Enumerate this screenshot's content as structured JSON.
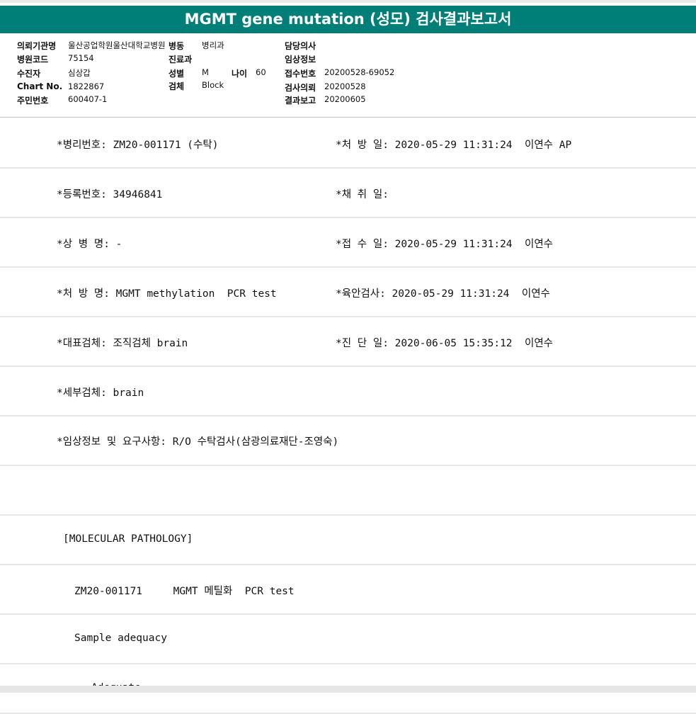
{
  "title": "MGMT gene mutation (성모) 검사결과보고서",
  "header": {
    "hospital_label": "의뢰기관명",
    "hospital_value": "울산공업학원울산대학교병원",
    "ward_label": "병동",
    "ward_value": "병리과",
    "doctor_label": "담당의사",
    "doctor_value": "",
    "code_label": "병원코드",
    "code_value": "75154",
    "dept_label": "진료과",
    "dept_value": "",
    "clinical_label": "임상정보",
    "clinical_value": "",
    "patient_label": "수진자",
    "patient_value": "심상갑",
    "sex_label": "성별",
    "sex_value": "M",
    "age_label": "나이",
    "age_value": "60",
    "receipt_label": "접수번호",
    "receipt_value": "20200528-69052",
    "chart_label": "Chart No.",
    "chart_value": "1822867",
    "specimen_label": "검체",
    "specimen_value": "Block",
    "request_label": "검사의뢰",
    "request_value": "20200528",
    "id_label": "주민번호",
    "id_value": "600407-1",
    "report_label": "결과보고",
    "report_value": "20200605"
  },
  "rows": [
    {
      "left": "*병리번호: ZM20-001171 (수탁)",
      "right": "*처 방 일: 2020-05-29 11:31:24  이연수 AP"
    },
    {
      "left": "*등록번호: 34946841",
      "right": "*채 취 일:"
    },
    {
      "left": "*상 병 명: -",
      "right": "*접 수 일: 2020-05-29 11:31:24  이연수"
    },
    {
      "left": "*처 방 명: MGMT methylation  PCR test",
      "right": "*육안검사: 2020-05-29 11:31:24  이연수"
    },
    {
      "left": "*대표검체: 조직검체 brain",
      "right": "*진 단 일: 2020-06-05 15:35:12  이연수"
    },
    {
      "left": "*세부검체: brain",
      "right": ""
    },
    {
      "left": "*임상정보 및 요구사항: R/O 수탁검사(삼광의료재단-조영숙)",
      "right": ""
    },
    {
      "left": "",
      "right": ""
    },
    {
      "left": "[MOLECULAR PATHOLOGY]",
      "right": ""
    },
    {
      "left": "ZM20-001171     MGMT 메틸화  PCR test",
      "right": ""
    },
    {
      "left": "Sample adequacy",
      "right": ""
    },
    {
      "left": "Adequate",
      "right": ""
    }
  ]
}
